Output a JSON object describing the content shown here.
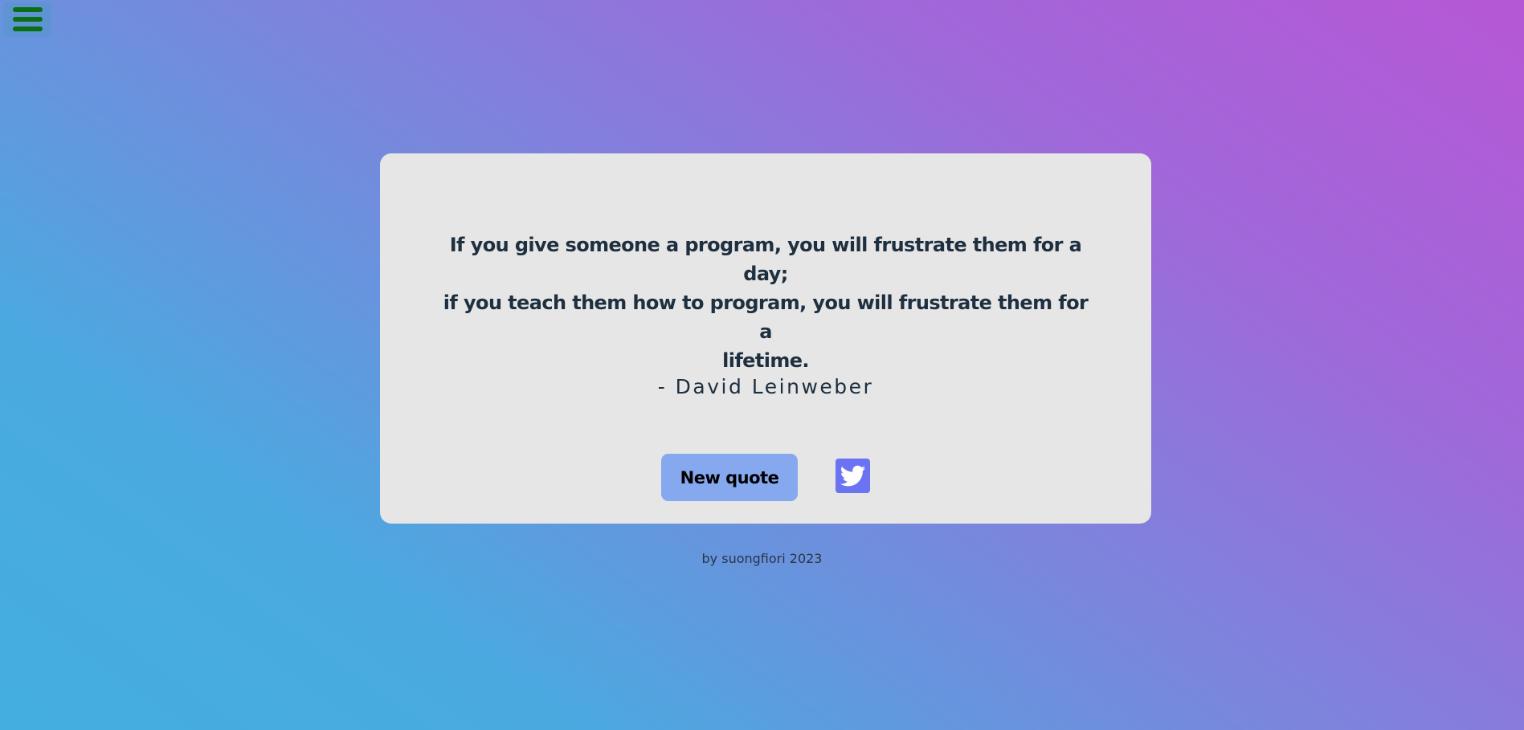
{
  "menu": {
    "icon": "hamburger-menu-icon",
    "icon_color": "#0a6e12"
  },
  "card": {
    "quote_line1": "If you give someone a program, you will frustrate them for a day;",
    "quote_line2": "if you teach them how to program, you will frustrate them for a",
    "quote_line3": "lifetime.",
    "author": "- David Leinweber",
    "new_quote_label": "New quote",
    "share_icon": "twitter-icon",
    "share_color": "#6c73f3",
    "button_color": "#86a8ef",
    "background": "#e6e6e6"
  },
  "footer": {
    "text": "by suongfiori 2023"
  }
}
